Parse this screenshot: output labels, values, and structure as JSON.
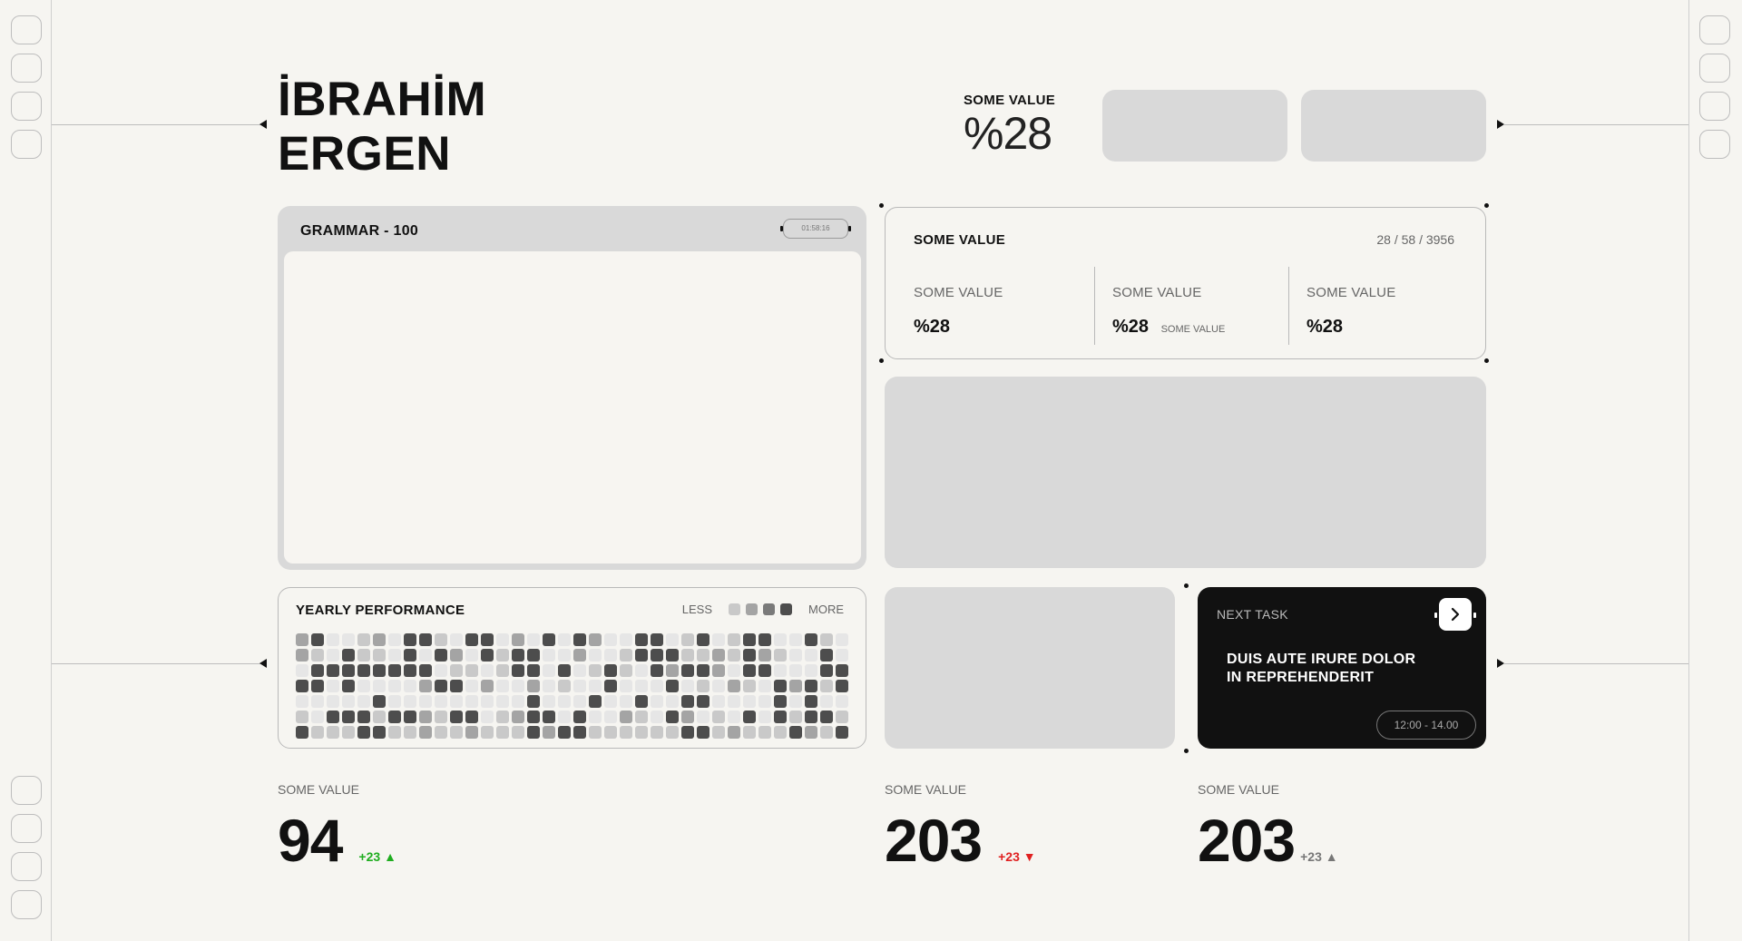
{
  "header": {
    "name_line1": "İBRAHİM",
    "name_line2": "ERGEN",
    "stat_label": "SOME VALUE",
    "stat_value": "%28"
  },
  "grammar": {
    "title": "GRAMMAR - 100",
    "time": "01:58:16"
  },
  "summary": {
    "title": "SOME VALUE",
    "counts": "28 / 58 / 3956",
    "cols": [
      {
        "label": "SOME VALUE",
        "value": "%28",
        "sub": ""
      },
      {
        "label": "SOME VALUE",
        "value": "%28",
        "sub": "SOME VALUE"
      },
      {
        "label": "SOME VALUE",
        "value": "%28",
        "sub": ""
      }
    ]
  },
  "yearly": {
    "title": "YEARLY PERFORMANCE",
    "less": "LESS",
    "more": "MORE",
    "levels": [
      "#c9c9c9",
      "#a4a4a4",
      "#7a7a7a",
      "#4d4d4d"
    ]
  },
  "next_task": {
    "label": "NEXT TASK",
    "title_line1": "DUIS AUTE IRURE DOLOR",
    "title_line2": "IN REPREHENDERIT",
    "time": "12:00 - 14.00",
    "arrow_icon": "chevron-right-icon"
  },
  "metrics": [
    {
      "label": "SOME VALUE",
      "value": "94",
      "delta": "+23",
      "direction": "up",
      "color": "#1fad1f"
    },
    {
      "label": "SOME VALUE",
      "value": "203",
      "delta": "+23",
      "direction": "down",
      "color": "#e02020"
    },
    {
      "label": "SOME VALUE",
      "value": "203",
      "delta": "+23",
      "direction": "up",
      "color": "#777777"
    }
  ],
  "colors": {
    "background": "#f6f5f1",
    "placeholder": "#d9d9d9",
    "dark": "#111111"
  }
}
